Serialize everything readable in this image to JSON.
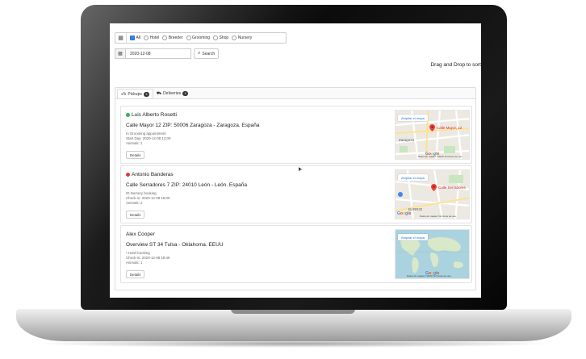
{
  "filters": {
    "options": [
      {
        "label": "All",
        "checked": true
      },
      {
        "label": "Hotel",
        "checked": false
      },
      {
        "label": "Breeder",
        "checked": false
      },
      {
        "label": "Grooming",
        "checked": false
      },
      {
        "label": "Shop",
        "checked": false
      },
      {
        "label": "Nursery",
        "checked": false
      }
    ]
  },
  "search": {
    "date_value": "2020-12-08",
    "button_label": "Search"
  },
  "drag_drop_text": "Drag and Drop to sort",
  "tabs": [
    {
      "label": "Pickups",
      "count": "3"
    },
    {
      "label": "Deliveries",
      "count": "4"
    }
  ],
  "cards": [
    {
      "name": "Luis Alberto Rosetti",
      "status_color": "#3cb043",
      "address": "Calle Mayor 12 ZIP: 50006 Zaragoza - Zaragoza. España",
      "service": "In Grooming appointment",
      "time": "Start Day: 2020-12-08 12:00",
      "animals": "Animals: 1",
      "details_label": "Details",
      "map": {
        "ampliar": "Ampliar el mapa",
        "pin_label": "Calle Mayor, 12",
        "extra_label": "Zaragoza",
        "footer": "Datos de mapas ©2020  Términos de uso",
        "style": "city"
      }
    },
    {
      "name": "Antonio Banderas",
      "status_color": "#e53935",
      "address": "Calle Serradores 7 ZIP: 24010 León - León. España",
      "service": "ID Nursery booking",
      "time": "Check-in: 2020-12-08 18:00",
      "animals": "Animals: 2",
      "details_label": "Details",
      "map": {
        "ampliar": "Ampliar el mapa",
        "pin_label": "Calle Serradores",
        "extra_label": "BARRIO",
        "footer": "Datos de mapas  Términos de uso",
        "style": "city"
      }
    },
    {
      "name": "Alex Cooper",
      "status_color": "",
      "address": "Overview ST 34 Tulsa - Oklahoma. EEUU",
      "service": "Hotel booking",
      "time": "Check-in: 2020-12-08 18:49",
      "animals": "Animals: 1",
      "details_label": "Details",
      "map": {
        "ampliar": "Ampliar el mapa",
        "pin_label": "",
        "extra_label": "",
        "footer": "Datos de mapas ©2020  Términos de uso",
        "style": "world"
      }
    }
  ],
  "colors": {
    "accent": "#3b82f6",
    "green": "#3cb043",
    "red": "#e53935",
    "map_road": "#ffffff",
    "map_bg": "#ece9e2",
    "map_water": "#aad3df"
  }
}
